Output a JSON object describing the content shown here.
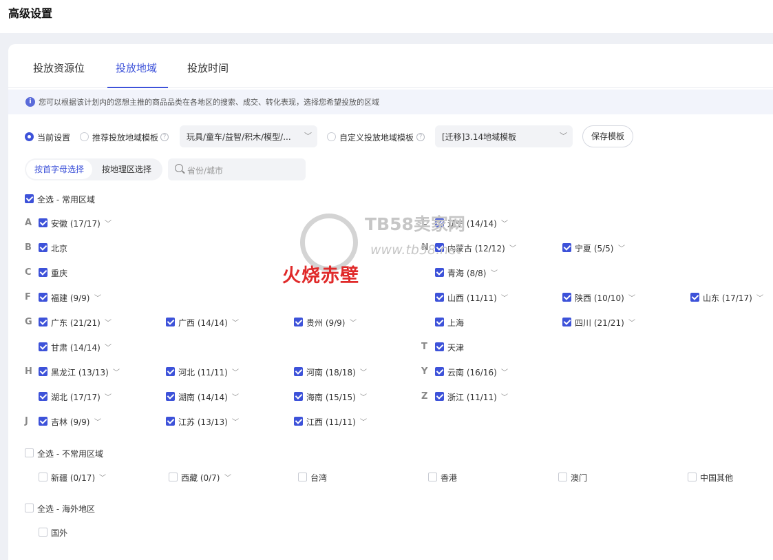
{
  "page_title": "高级设置",
  "tabs": [
    {
      "label": "投放资源位",
      "active": false
    },
    {
      "label": "投放地域",
      "active": true
    },
    {
      "label": "投放时间",
      "active": false
    }
  ],
  "info_text": "您可以根据该计划内的您想主推的商品品类在各地区的搜索、成交、转化表现，选择您希望投放的区域",
  "options": {
    "current_label": "当前设置",
    "recommend_label": "推荐投放地域模板",
    "recommend_value": "玩具/童车/益智/积木/模型/...",
    "custom_label": "自定义投放地域模板",
    "custom_value": "[迁移]3.14地域模板",
    "save_label": "保存模板"
  },
  "select_mode": {
    "alpha": "按首字母选择",
    "geo": "按地理区选择"
  },
  "search_placeholder": "省份/城市",
  "common": {
    "select_all_label": "全选 - 常用区域",
    "left_letters": [
      "A",
      "B",
      "C",
      "F",
      "G",
      "H",
      "J"
    ],
    "right_letters": [
      "L",
      "N",
      "T",
      "Y",
      "Z"
    ],
    "items": [
      {
        "name": "安徽 (17/17)",
        "chevron": true
      },
      {
        "name": "北京",
        "chevron": false
      },
      {
        "name": "重庆",
        "chevron": false
      },
      {
        "name": "福建 (9/9)",
        "chevron": true
      },
      {
        "name": "广东 (21/21)",
        "chevron": true
      },
      {
        "name": "广西 (14/14)",
        "chevron": true
      },
      {
        "name": "贵州 (9/9)",
        "chevron": true
      },
      {
        "name": "甘肃 (14/14)",
        "chevron": true
      },
      {
        "name": "黑龙江 (13/13)",
        "chevron": true
      },
      {
        "name": "河北 (11/11)",
        "chevron": true
      },
      {
        "name": "河南 (18/18)",
        "chevron": true
      },
      {
        "name": "湖北 (17/17)",
        "chevron": true
      },
      {
        "name": "湖南 (14/14)",
        "chevron": true
      },
      {
        "name": "海南 (15/15)",
        "chevron": true
      },
      {
        "name": "吉林 (9/9)",
        "chevron": true
      },
      {
        "name": "江苏 (13/13)",
        "chevron": true
      },
      {
        "name": "江西 (11/11)",
        "chevron": true
      },
      {
        "name": "辽宁 (14/14)",
        "chevron": true
      },
      {
        "name": "内蒙古 (12/12)",
        "chevron": true
      },
      {
        "name": "宁夏 (5/5)",
        "chevron": true
      },
      {
        "name": "青海 (8/8)",
        "chevron": true
      },
      {
        "name": "山西 (11/11)",
        "chevron": true
      },
      {
        "name": "陕西 (10/10)",
        "chevron": true
      },
      {
        "name": "山东 (17/17)",
        "chevron": true
      },
      {
        "name": "上海",
        "chevron": false
      },
      {
        "name": "四川 (21/21)",
        "chevron": true
      },
      {
        "name": "天津",
        "chevron": false
      },
      {
        "name": "云南 (16/16)",
        "chevron": true
      },
      {
        "name": "浙江 (11/11)",
        "chevron": true
      }
    ]
  },
  "uncommon": {
    "select_all_label": "全选 - 不常用区域",
    "items": [
      {
        "name": "新疆 (0/17)",
        "chevron": true
      },
      {
        "name": "西藏 (0/7)",
        "chevron": true
      },
      {
        "name": "台湾",
        "chevron": false
      },
      {
        "name": "香港",
        "chevron": false
      },
      {
        "name": "澳门",
        "chevron": false
      },
      {
        "name": "中国其他",
        "chevron": false
      }
    ]
  },
  "overseas": {
    "select_all_label": "全选 - 海外地区",
    "items": [
      {
        "name": "国外",
        "chevron": false
      }
    ]
  },
  "watermark": {
    "brand": "TB58卖家网",
    "url": "www.tb58.net",
    "caption": "火烧赤壁"
  }
}
